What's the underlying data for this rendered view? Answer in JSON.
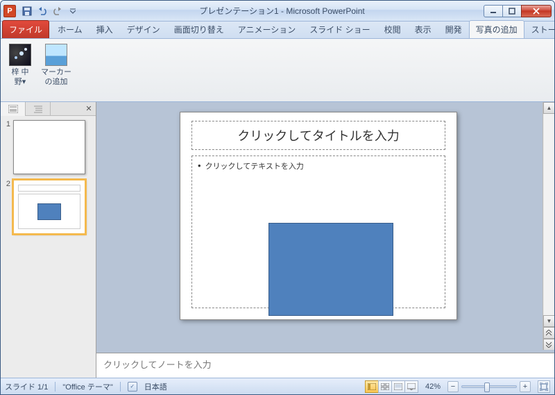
{
  "title": "プレゼンテーション1 - Microsoft PowerPoint",
  "tabs": {
    "file": "ファイル",
    "home": "ホーム",
    "insert": "挿入",
    "design": "デザイン",
    "transitions": "画面切り替え",
    "animations": "アニメーション",
    "slideshow": "スライド ショー",
    "review": "校閲",
    "view": "表示",
    "developer": "開発",
    "addphoto": "写真の追加",
    "storyboard": "ストーリーボーディング"
  },
  "ribbon": {
    "btn1_line1": "梓 中",
    "btn1_line2": "野▾",
    "btn2_line1": "マーカー",
    "btn2_line2": "の追加"
  },
  "slides": [
    {
      "num": "1"
    },
    {
      "num": "2"
    }
  ],
  "placeholders": {
    "title": "クリックしてタイトルを入力",
    "body": "クリックしてテキストを入力"
  },
  "notes": {
    "placeholder": "クリックしてノートを入力"
  },
  "status": {
    "slide": "スライド 1/1",
    "theme": "\"Office テーマ\"",
    "lang": "日本語",
    "zoom": "42%"
  },
  "icons": {
    "app": "P"
  }
}
